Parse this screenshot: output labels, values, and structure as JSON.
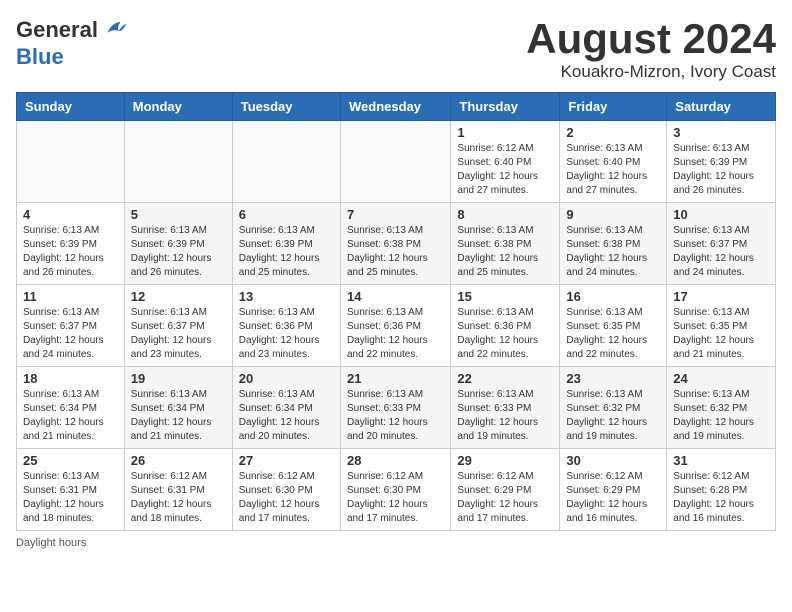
{
  "logo": {
    "general": "General",
    "blue": "Blue"
  },
  "title": "August 2024",
  "subtitle": "Kouakro-Mizron, Ivory Coast",
  "footer_note": "Daylight hours",
  "days_of_week": [
    "Sunday",
    "Monday",
    "Tuesday",
    "Wednesday",
    "Thursday",
    "Friday",
    "Saturday"
  ],
  "weeks": [
    [
      {
        "day": "",
        "info": ""
      },
      {
        "day": "",
        "info": ""
      },
      {
        "day": "",
        "info": ""
      },
      {
        "day": "",
        "info": ""
      },
      {
        "day": "1",
        "info": "Sunrise: 6:12 AM\nSunset: 6:40 PM\nDaylight: 12 hours\nand 27 minutes."
      },
      {
        "day": "2",
        "info": "Sunrise: 6:13 AM\nSunset: 6:40 PM\nDaylight: 12 hours\nand 27 minutes."
      },
      {
        "day": "3",
        "info": "Sunrise: 6:13 AM\nSunset: 6:39 PM\nDaylight: 12 hours\nand 26 minutes."
      }
    ],
    [
      {
        "day": "4",
        "info": "Sunrise: 6:13 AM\nSunset: 6:39 PM\nDaylight: 12 hours\nand 26 minutes."
      },
      {
        "day": "5",
        "info": "Sunrise: 6:13 AM\nSunset: 6:39 PM\nDaylight: 12 hours\nand 26 minutes."
      },
      {
        "day": "6",
        "info": "Sunrise: 6:13 AM\nSunset: 6:39 PM\nDaylight: 12 hours\nand 25 minutes."
      },
      {
        "day": "7",
        "info": "Sunrise: 6:13 AM\nSunset: 6:38 PM\nDaylight: 12 hours\nand 25 minutes."
      },
      {
        "day": "8",
        "info": "Sunrise: 6:13 AM\nSunset: 6:38 PM\nDaylight: 12 hours\nand 25 minutes."
      },
      {
        "day": "9",
        "info": "Sunrise: 6:13 AM\nSunset: 6:38 PM\nDaylight: 12 hours\nand 24 minutes."
      },
      {
        "day": "10",
        "info": "Sunrise: 6:13 AM\nSunset: 6:37 PM\nDaylight: 12 hours\nand 24 minutes."
      }
    ],
    [
      {
        "day": "11",
        "info": "Sunrise: 6:13 AM\nSunset: 6:37 PM\nDaylight: 12 hours\nand 24 minutes."
      },
      {
        "day": "12",
        "info": "Sunrise: 6:13 AM\nSunset: 6:37 PM\nDaylight: 12 hours\nand 23 minutes."
      },
      {
        "day": "13",
        "info": "Sunrise: 6:13 AM\nSunset: 6:36 PM\nDaylight: 12 hours\nand 23 minutes."
      },
      {
        "day": "14",
        "info": "Sunrise: 6:13 AM\nSunset: 6:36 PM\nDaylight: 12 hours\nand 22 minutes."
      },
      {
        "day": "15",
        "info": "Sunrise: 6:13 AM\nSunset: 6:36 PM\nDaylight: 12 hours\nand 22 minutes."
      },
      {
        "day": "16",
        "info": "Sunrise: 6:13 AM\nSunset: 6:35 PM\nDaylight: 12 hours\nand 22 minutes."
      },
      {
        "day": "17",
        "info": "Sunrise: 6:13 AM\nSunset: 6:35 PM\nDaylight: 12 hours\nand 21 minutes."
      }
    ],
    [
      {
        "day": "18",
        "info": "Sunrise: 6:13 AM\nSunset: 6:34 PM\nDaylight: 12 hours\nand 21 minutes."
      },
      {
        "day": "19",
        "info": "Sunrise: 6:13 AM\nSunset: 6:34 PM\nDaylight: 12 hours\nand 21 minutes."
      },
      {
        "day": "20",
        "info": "Sunrise: 6:13 AM\nSunset: 6:34 PM\nDaylight: 12 hours\nand 20 minutes."
      },
      {
        "day": "21",
        "info": "Sunrise: 6:13 AM\nSunset: 6:33 PM\nDaylight: 12 hours\nand 20 minutes."
      },
      {
        "day": "22",
        "info": "Sunrise: 6:13 AM\nSunset: 6:33 PM\nDaylight: 12 hours\nand 19 minutes."
      },
      {
        "day": "23",
        "info": "Sunrise: 6:13 AM\nSunset: 6:32 PM\nDaylight: 12 hours\nand 19 minutes."
      },
      {
        "day": "24",
        "info": "Sunrise: 6:13 AM\nSunset: 6:32 PM\nDaylight: 12 hours\nand 19 minutes."
      }
    ],
    [
      {
        "day": "25",
        "info": "Sunrise: 6:13 AM\nSunset: 6:31 PM\nDaylight: 12 hours\nand 18 minutes."
      },
      {
        "day": "26",
        "info": "Sunrise: 6:12 AM\nSunset: 6:31 PM\nDaylight: 12 hours\nand 18 minutes."
      },
      {
        "day": "27",
        "info": "Sunrise: 6:12 AM\nSunset: 6:30 PM\nDaylight: 12 hours\nand 17 minutes."
      },
      {
        "day": "28",
        "info": "Sunrise: 6:12 AM\nSunset: 6:30 PM\nDaylight: 12 hours\nand 17 minutes."
      },
      {
        "day": "29",
        "info": "Sunrise: 6:12 AM\nSunset: 6:29 PM\nDaylight: 12 hours\nand 17 minutes."
      },
      {
        "day": "30",
        "info": "Sunrise: 6:12 AM\nSunset: 6:29 PM\nDaylight: 12 hours\nand 16 minutes."
      },
      {
        "day": "31",
        "info": "Sunrise: 6:12 AM\nSunset: 6:28 PM\nDaylight: 12 hours\nand 16 minutes."
      }
    ]
  ]
}
